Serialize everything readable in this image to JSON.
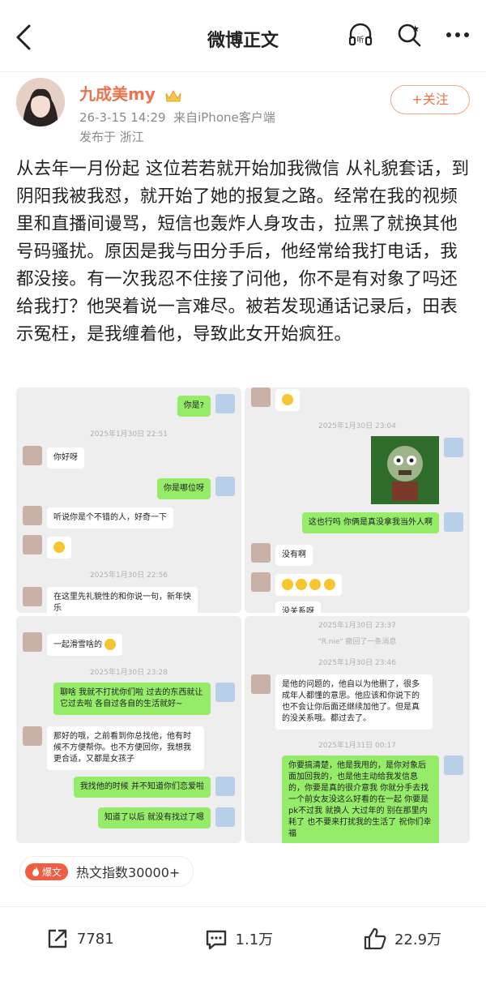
{
  "header": {
    "title": "微博正文"
  },
  "post": {
    "author": "九成美my",
    "timestamp": "26-3-15 14:29",
    "source": "来自iPhone客户端",
    "location": "发布于 浙江",
    "follow_label": "+关注",
    "text": "从去年一月份起 这位若若就开始加我微信 从礼貌套话，到阴阳我被我怼，就开始了她的报复之路。经常在我的视频里和直播间谩骂，短信也轰炸人身攻击，拉黑了就换其他号码骚扰。原因是我与田分手后，他经常给我打电话，我都没接。有一次我忍不住接了问他，你不是有对象了吗还给我打？他哭着说一言难尽。被若发现通话记录后，田表示冤枉，是我缠着他，导致此女开始疯狂。"
  },
  "chats": {
    "shot1": {
      "m1": "你是?",
      "t1": "2025年1月30日 22:51",
      "m2": "你好呀",
      "m3": "你是哪位呀",
      "m4": "听说你是个不错的人，好奇一下",
      "t2": "2025年1月30日 22:56",
      "m5": "在这里先礼貌性的和你说一句，新年快乐"
    },
    "shot2": {
      "t1": "2025年1月30日 23:04",
      "m1": "这也行吗 你俩是真没拿我当外人啊",
      "m2": "没有啊",
      "m3": "没关系呀"
    },
    "shot3": {
      "m1": "一起滑雪啥的",
      "t1": "2025年1月30日 23:28",
      "m2": "聊啥 我就不打扰你们啦 过去的东西就让它过去啦 各自过各自的生活就好~",
      "m3": "那好的哦，之前看到你总找他，他有时候不方便帮你。也不方便回你，我想我更合适，又都是女孩子",
      "m4": "我找他的时候 并不知道你们恋爱啦",
      "m5": "知道了以后 就没有找过了嗯"
    },
    "shot4": {
      "t1": "2025年1月30日 23:37",
      "recall": "\"R.nie\" 撤回了一条消息",
      "t2": "2025年1月30日 23:46",
      "m1": "是他的问题的，他自以为他删了，很多成年人都懂的意思。他应该和你说下的 也不会让你后面还继续加他了。但是真的没关系哦。都过去了。",
      "t3": "2025年1月31日 00:17",
      "m2": "你要搞清楚，他是我甩的，是你对象后面加回我的，也是他主动给我发信息的，你要是真的很介意我 你就分手去找一个前女友没这么好看的在一起 你要是pk不过我 就换人 大过年的 别在那里内耗了 也不要来打扰我的生活了 祝你们幸福"
    }
  },
  "badge": {
    "label": "爆文",
    "text": "热文指数30000+"
  },
  "actions": {
    "share": "7781",
    "comment": "1.1万",
    "like": "22.9万"
  },
  "colors": {
    "accent": "#eb7350",
    "wechat_green": "#95ec69",
    "badge_red": "#f15d42"
  }
}
